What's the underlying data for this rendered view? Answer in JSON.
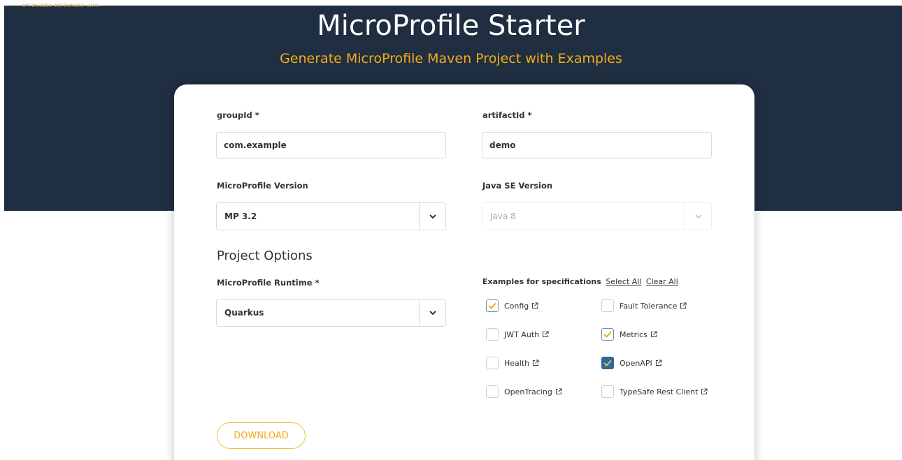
{
  "header": {
    "tagline": "OPTIMIZING ENTERPRISE JAVA",
    "title": "MicroProfile Starter",
    "subtitle": "Generate MicroProfile Maven Project with Examples"
  },
  "form": {
    "groupId": {
      "label": "groupId",
      "required_mark": "*",
      "value": "com.example"
    },
    "artifactId": {
      "label": "artifactId",
      "required_mark": "*",
      "value": "demo"
    },
    "mp_version": {
      "label": "MicroProfile Version",
      "value": "MP 3.2"
    },
    "java_version": {
      "label": "Java SE Version",
      "value": "Java 8"
    },
    "section_title": "Project Options",
    "runtime": {
      "label": "MicroProfile Runtime",
      "required_mark": "*",
      "value": "Quarkus"
    },
    "examples": {
      "label": "Examples for specifications",
      "select_all": "Select All",
      "clear_all": "Clear All",
      "items": [
        {
          "label": "Config",
          "checked": true
        },
        {
          "label": "Fault Tolerance",
          "checked": false
        },
        {
          "label": "JWT Auth",
          "checked": false
        },
        {
          "label": "Metrics",
          "checked": true
        },
        {
          "label": "Health",
          "checked": false
        },
        {
          "label": "OpenAPI",
          "checked": true
        },
        {
          "label": "OpenTracing",
          "checked": false
        },
        {
          "label": "TypeSafe Rest Client",
          "checked": false
        }
      ]
    },
    "download_label": "DOWNLOAD"
  },
  "colors": {
    "header_bg": "#1f2e40",
    "accent": "#f2ac1c",
    "checked_dark": "#2b6a9a"
  }
}
